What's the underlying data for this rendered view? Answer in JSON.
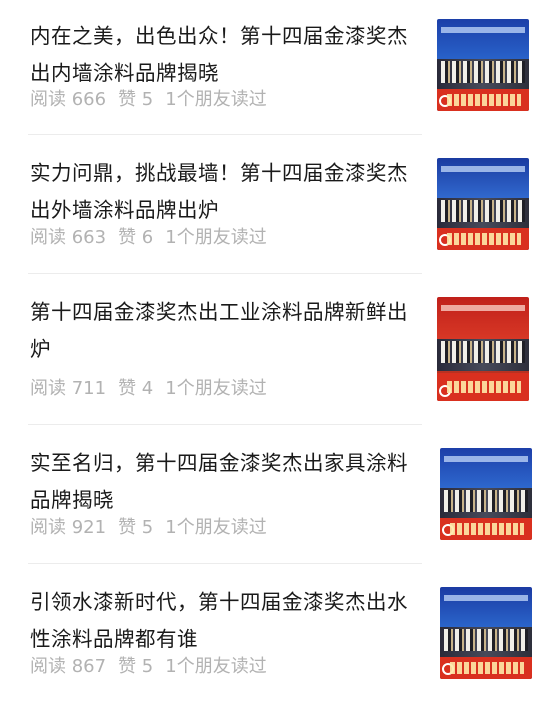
{
  "articles": [
    {
      "title": "内在之美，出色出众！第十四届金漆奖杰出内墙涂料品牌揭晓",
      "reads": "阅读 666",
      "likes": "赞 5",
      "friends": "1个朋友读过"
    },
    {
      "title": "实力问鼎，挑战最墙！第十四届金漆奖杰出外墙涂料品牌出炉",
      "reads": "阅读 663",
      "likes": "赞 6",
      "friends": "1个朋友读过"
    },
    {
      "title": "第十四届金漆奖杰出工业涂料品牌新鲜出炉",
      "reads": "阅读 711",
      "likes": "赞 4",
      "friends": "1个朋友读过"
    },
    {
      "title": "实至名归，第十四届金漆奖杰出家具涂料品牌揭晓",
      "reads": "阅读 921",
      "likes": "赞 5",
      "friends": "1个朋友读过"
    },
    {
      "title": "引领水漆新时代，第十四届金漆奖杰出水性涂料品牌都有谁",
      "reads": "阅读 867",
      "likes": "赞 5",
      "friends": "1个朋友读过"
    }
  ],
  "colors": {
    "title": "#1a1a1a",
    "meta": "#b2b2b2",
    "divider": "#ececec"
  }
}
